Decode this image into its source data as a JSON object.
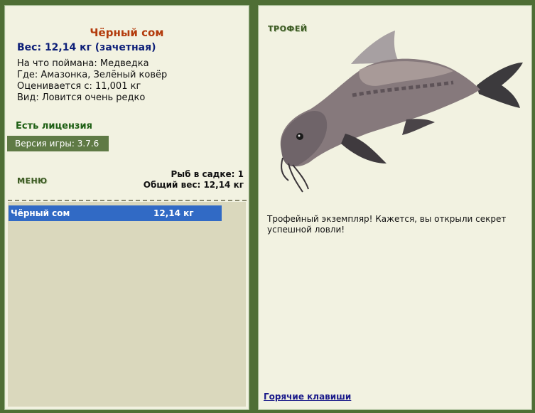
{
  "fish": {
    "name": "Чёрный сом",
    "weight_line": "Вес: 12,14 кг (зачетная)",
    "bait_line": "На что поймана: Медведка",
    "location_line": "Где: Амазонка, Зелёный ковёр",
    "value_line": "Оценивается с: 11,001 кг",
    "rarity_line": "Вид: Ловится очень редко"
  },
  "license": "Есть лицензия",
  "version": {
    "label": "Версия игры:",
    "value": "3.7.6"
  },
  "menu_label": "МЕНЮ",
  "summary": {
    "count_line": "Рыб в садке: 1",
    "total_line": "Общий вес: 12,14 кг"
  },
  "catch_list": [
    {
      "name": "Чёрный сом",
      "weight": "12,14 кг"
    }
  ],
  "trophy": {
    "label": "ТРОФЕЙ",
    "text": "Трофейный экземпляр! Кажется, вы открыли секрет успешной ловли!"
  },
  "hotkeys_link": "Горячие клавиши"
}
